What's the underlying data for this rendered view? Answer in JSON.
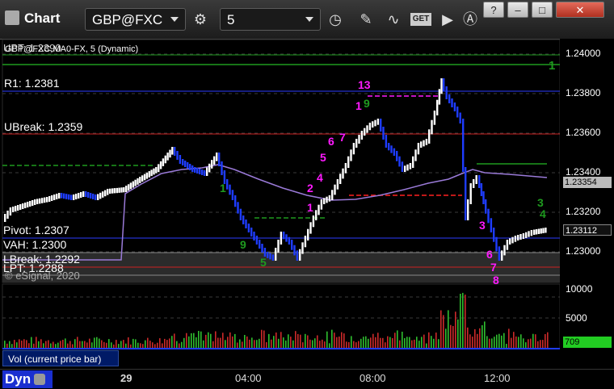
{
  "app": {
    "title": "Chart"
  },
  "toolbar": {
    "symbol": "GBP@FXC",
    "interval": "5",
    "get_label": "GET"
  },
  "window_buttons": {
    "help": "?",
    "minimize": "–",
    "maximize": "□",
    "close": "✕"
  },
  "chart": {
    "ma_caption": "GBP@FXC,MA0-FX, 5 (Dynamic)",
    "copyright": "© eSignal, 2020",
    "levels": [
      {
        "label": "UPT: 1.2390"
      },
      {
        "label": "R1: 1.2381"
      },
      {
        "label": "UBreak: 1.2359"
      },
      {
        "label": "Pivot: 1.2307"
      },
      {
        "label": "VAH: 1.2300"
      },
      {
        "label": "LBreak: 1.2292"
      },
      {
        "label": "LPT: 1.2288"
      }
    ],
    "price_axis": [
      "1.24000",
      "1.23800",
      "1.23600",
      "1.23400",
      "1.23200",
      "1.23000"
    ],
    "price_tags": {
      "ma": "1.23354",
      "last": "1.23112"
    },
    "volume_axis": [
      "10000",
      "5000"
    ],
    "volume_tag": "709",
    "volume_label": "Vol (current price bar)",
    "time_axis": [
      "29",
      "04:00",
      "08:00",
      "12:00"
    ],
    "dyn_label": "Dyn"
  },
  "colors": {
    "up_bar": "#ffffff",
    "down_bar": "#1e3cff",
    "ma": "#9a7ad8",
    "td_magenta": "#ff1aff",
    "td_green": "#1f9a1f"
  }
}
